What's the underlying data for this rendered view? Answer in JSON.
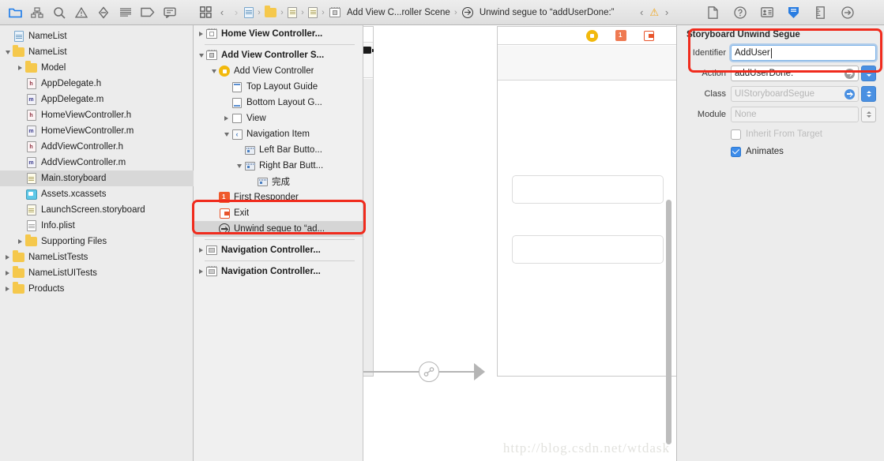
{
  "navigator": {
    "toolbar_icons": [
      {
        "name": "project-navigator-icon",
        "active": true
      },
      {
        "name": "source-control-navigator-icon",
        "active": false
      },
      {
        "name": "symbol-navigator-icon",
        "active": false
      },
      {
        "name": "issue-navigator-icon",
        "active": false
      },
      {
        "name": "test-navigator-icon",
        "active": false
      },
      {
        "name": "debug-navigator-icon",
        "active": false
      },
      {
        "name": "breakpoint-navigator-icon",
        "active": false
      },
      {
        "name": "report-navigator-icon",
        "active": false
      }
    ],
    "files": [
      {
        "label": "NameList",
        "indent": 0,
        "twisty": "none",
        "icon": "project",
        "selected": false
      },
      {
        "label": "NameList",
        "indent": 0,
        "twisty": "down",
        "icon": "folder",
        "selected": false
      },
      {
        "label": "Model",
        "indent": 1,
        "twisty": "right",
        "icon": "folder",
        "selected": false
      },
      {
        "label": "AppDelegate.h",
        "indent": 1,
        "twisty": "none",
        "icon": "header",
        "selected": false
      },
      {
        "label": "AppDelegate.m",
        "indent": 1,
        "twisty": "none",
        "icon": "impl",
        "selected": false
      },
      {
        "label": "HomeViewController.h",
        "indent": 1,
        "twisty": "none",
        "icon": "header",
        "selected": false
      },
      {
        "label": "HomeViewController.m",
        "indent": 1,
        "twisty": "none",
        "icon": "impl",
        "selected": false
      },
      {
        "label": "AddViewController.h",
        "indent": 1,
        "twisty": "none",
        "icon": "header",
        "selected": false
      },
      {
        "label": "AddViewController.m",
        "indent": 1,
        "twisty": "none",
        "icon": "impl",
        "selected": false
      },
      {
        "label": "Main.storyboard",
        "indent": 1,
        "twisty": "none",
        "icon": "storyboard",
        "selected": true
      },
      {
        "label": "Assets.xcassets",
        "indent": 1,
        "twisty": "none",
        "icon": "xcassets",
        "selected": false
      },
      {
        "label": "LaunchScreen.storyboard",
        "indent": 1,
        "twisty": "none",
        "icon": "storyboard",
        "selected": false
      },
      {
        "label": "Info.plist",
        "indent": 1,
        "twisty": "none",
        "icon": "plist",
        "selected": false
      },
      {
        "label": "Supporting Files",
        "indent": 1,
        "twisty": "right",
        "icon": "folder",
        "selected": false
      },
      {
        "label": "NameListTests",
        "indent": 0,
        "twisty": "right",
        "icon": "folder",
        "selected": false
      },
      {
        "label": "NameListUITests",
        "indent": 0,
        "twisty": "right",
        "icon": "folder",
        "selected": false
      },
      {
        "label": "Products",
        "indent": 0,
        "twisty": "right",
        "icon": "folder",
        "selected": false
      }
    ]
  },
  "outline": {
    "rows": [
      {
        "type": "row",
        "label": "Home View Controller...",
        "indent": 0,
        "twisty": "right",
        "icon": "scene",
        "bold": true,
        "selected": false
      },
      {
        "type": "sep"
      },
      {
        "type": "row",
        "label": "Add View Controller S...",
        "indent": 0,
        "twisty": "down",
        "icon": "scene-filled",
        "bold": true,
        "selected": false
      },
      {
        "type": "row",
        "label": "Add View Controller",
        "indent": 1,
        "twisty": "down",
        "icon": "vc",
        "bold": false,
        "selected": false
      },
      {
        "type": "row",
        "label": "Top Layout Guide",
        "indent": 2,
        "twisty": "none",
        "icon": "guide-top",
        "bold": false,
        "selected": false
      },
      {
        "type": "row",
        "label": "Bottom Layout G...",
        "indent": 2,
        "twisty": "none",
        "icon": "guide-bottom",
        "bold": false,
        "selected": false
      },
      {
        "type": "row",
        "label": "View",
        "indent": 2,
        "twisty": "right",
        "icon": "view",
        "bold": false,
        "selected": false
      },
      {
        "type": "row",
        "label": "Navigation Item",
        "indent": 2,
        "twisty": "down",
        "icon": "navitem",
        "bold": false,
        "selected": false
      },
      {
        "type": "row",
        "label": "Left Bar Butto...",
        "indent": 3,
        "twisty": "none",
        "icon": "barbutton",
        "bold": false,
        "selected": false
      },
      {
        "type": "row",
        "label": "Right Bar Butt...",
        "indent": 3,
        "twisty": "down",
        "icon": "barbutton",
        "bold": false,
        "selected": false
      },
      {
        "type": "row",
        "label": "完成",
        "indent": 4,
        "twisty": "none",
        "icon": "barbutton",
        "bold": false,
        "selected": false
      },
      {
        "type": "row",
        "label": "First Responder",
        "indent": 1,
        "twisty": "none",
        "icon": "firstresponder",
        "bold": false,
        "selected": false
      },
      {
        "type": "row",
        "label": "Exit",
        "indent": 1,
        "twisty": "none",
        "icon": "exit",
        "bold": false,
        "selected": false
      },
      {
        "type": "row",
        "label": "Unwind segue to “ad...",
        "indent": 1,
        "twisty": "none",
        "icon": "unwind",
        "bold": false,
        "selected": true
      },
      {
        "type": "sep"
      },
      {
        "type": "row",
        "label": "Navigation Controller...",
        "indent": 0,
        "twisty": "right",
        "icon": "navctrl",
        "bold": true,
        "selected": false
      },
      {
        "type": "sep"
      },
      {
        "type": "row",
        "label": "Navigation Controller...",
        "indent": 0,
        "twisty": "right",
        "icon": "navctrl-hat",
        "bold": true,
        "selected": false
      }
    ]
  },
  "jumpbar": {
    "related_items_icon": "related-items-icon",
    "back_label": "‹",
    "forward_label": "›",
    "crumbs": [
      {
        "icon": "project-icon",
        "label": ""
      },
      {
        "icon": "folder-icon",
        "label": ""
      },
      {
        "icon": "group-icon",
        "label": ""
      },
      {
        "icon": "storyboard-icon",
        "label": ""
      },
      {
        "icon": "scene-icon",
        "label": "Add View C...roller Scene"
      },
      {
        "icon": "unwind-segue-icon",
        "label": "Unwind segue to “addUserDone:”"
      }
    ],
    "issue_prev": "‹",
    "issue_warning_icon": "warning-triangle-icon",
    "issue_next": "›"
  },
  "inspector_toolbar": {
    "icons": [
      {
        "name": "file-inspector-icon",
        "active": false
      },
      {
        "name": "quick-help-inspector-icon",
        "active": false
      },
      {
        "name": "identity-inspector-icon",
        "active": false
      },
      {
        "name": "attributes-inspector-icon",
        "active": true
      },
      {
        "name": "size-inspector-icon",
        "active": false
      },
      {
        "name": "connections-inspector-icon",
        "active": false
      }
    ]
  },
  "inspector": {
    "section_title": "Storyboard Unwind Segue",
    "identifier": {
      "label": "Identifier",
      "value": "AddUser",
      "placeholder": ""
    },
    "action": {
      "label": "Action",
      "value": "addUserDone:"
    },
    "class": {
      "label": "Class",
      "value": "UIStoryboardSegue"
    },
    "module": {
      "label": "Module",
      "value": "None"
    },
    "inherit_from_target": {
      "label": "Inherit From Target",
      "checked": false,
      "disabled": true
    },
    "animates": {
      "label": "Animates",
      "checked": true,
      "disabled": false
    },
    "accent_color": "#3c8cea"
  },
  "canvas": {
    "tooltip_label": "Add View Controller",
    "scene_icons": [
      {
        "name": "view-controller-dot-icon"
      },
      {
        "name": "first-responder-dot-icon"
      },
      {
        "name": "exit-dot-icon"
      }
    ]
  },
  "watermark": "http://blog.csdn.net/wtdask"
}
